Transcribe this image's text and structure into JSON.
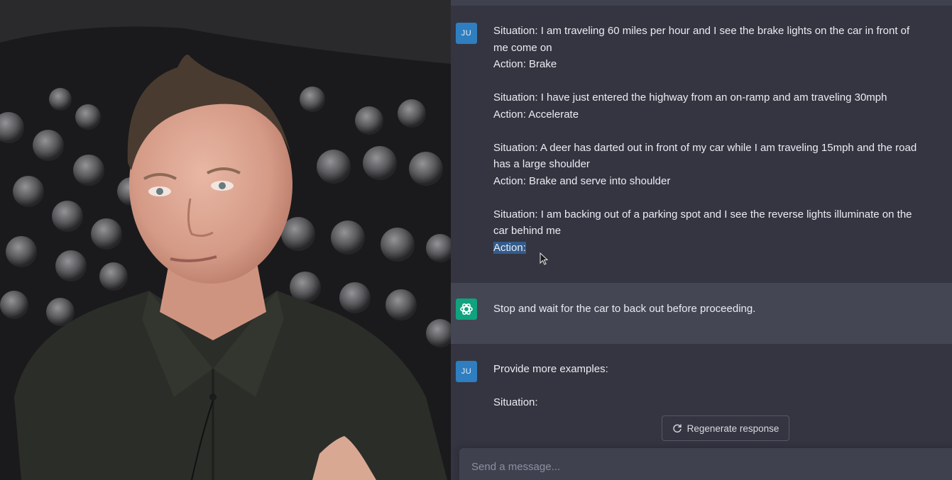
{
  "chat": {
    "messages": [
      {
        "role": "user",
        "avatar": "JU",
        "lines": [
          "Situation: I am traveling 60 miles per hour and I see the brake lights on the car in front of",
          "me come on",
          "Action: Brake",
          "",
          "Situation: I have just entered the highway from an on-ramp and am traveling 30mph",
          "Action: Accelerate",
          "",
          "Situation: A deer has darted out in front of my car while I am traveling 15mph and the road",
          "has a large shoulder",
          "Action: Brake and serve into shoulder",
          "",
          "Situation: I am backing out of a parking spot and I see the reverse lights illuminate on the",
          "car behind me",
          "Action:"
        ]
      },
      {
        "role": "assistant",
        "avatar_icon": "openai-logo-icon",
        "lines": [
          "Stop and wait for the car to back out before proceeding."
        ]
      },
      {
        "role": "user",
        "avatar": "JU",
        "lines": [
          "Provide more examples:",
          "",
          "Situation:"
        ]
      }
    ],
    "regenerate_label": "Regenerate response",
    "composer_placeholder": "Send a message..."
  },
  "colors": {
    "chat_bg": "#343541",
    "assistant_bg": "#444654",
    "user_avatar": "#2f7ebf",
    "assistant_avatar": "#10a37f",
    "selection": "#335c8c"
  }
}
